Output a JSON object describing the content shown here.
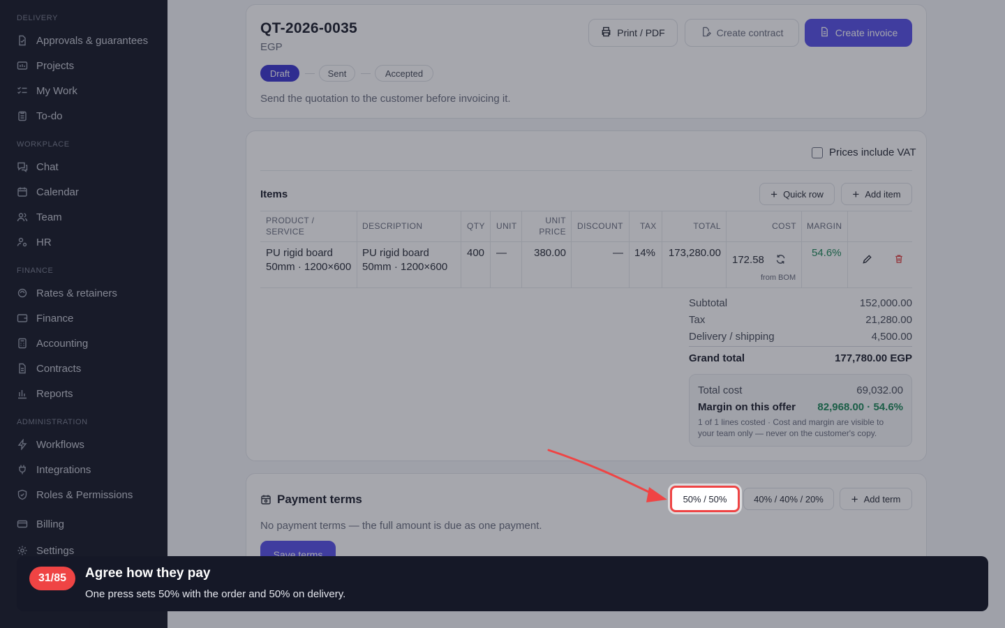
{
  "sidebar": {
    "sections": [
      {
        "label": "DELIVERY",
        "items": [
          "Approvals & guarantees",
          "Projects",
          "My Work",
          "To-do"
        ]
      },
      {
        "label": "WORKPLACE",
        "items": [
          "Chat",
          "Calendar",
          "Team",
          "HR"
        ]
      },
      {
        "label": "FINANCE",
        "items": [
          "Rates & retainers",
          "Finance",
          "Accounting",
          "Contracts",
          "Reports"
        ]
      },
      {
        "label": "ADMINISTRATION",
        "items": [
          "Workflows",
          "Integrations",
          "Roles & Permissions"
        ]
      }
    ],
    "billing": "Billing",
    "settings": "Settings"
  },
  "quote": {
    "number": "QT-2026-0035",
    "currency": "EGP",
    "print_label": "Print / PDF",
    "contract_label": "Create contract",
    "invoice_label": "Create invoice",
    "stages": [
      "Draft",
      "Sent",
      "Accepted"
    ],
    "active_stage": "Draft",
    "hint": "Send the quotation to the customer before invoicing it."
  },
  "items": {
    "vat_label": "Prices include VAT",
    "title": "Items",
    "quick_row": "Quick row",
    "add_item": "Add item",
    "columns": [
      "PRODUCT / SERVICE",
      "DESCRIPTION",
      "QTY",
      "UNIT",
      "UNIT PRICE",
      "DISCOUNT",
      "TAX",
      "TOTAL",
      "COST",
      "MARGIN"
    ],
    "row": {
      "product": "PU rigid board 50mm · 1200×600",
      "description": "PU rigid board 50mm · 1200×600",
      "qty": "400",
      "unit": "—",
      "unit_price": "380.00",
      "discount": "—",
      "tax": "14%",
      "total": "173,280.00",
      "cost": "172.58",
      "cost_note": "from BOM",
      "margin": "54.6%"
    }
  },
  "totals": {
    "subtotal_label": "Subtotal",
    "subtotal": "152,000.00",
    "tax_label": "Tax",
    "tax": "21,280.00",
    "delivery_label": "Delivery / shipping",
    "delivery": "4,500.00",
    "grand_label": "Grand total",
    "grand": "177,780.00 EGP",
    "cost_label": "Total cost",
    "cost": "69,032.00",
    "margin_label": "Margin on this offer",
    "margin": "82,968.00 · 54.6%",
    "note": "1 of 1 lines costed · Cost and margin are visible to your team only — never on the customer's copy."
  },
  "payment": {
    "title": "Payment terms",
    "preset1": "50% / 50%",
    "preset2": "40% / 40% / 20%",
    "add_term": "Add term",
    "empty": "No payment terms — the full amount is due as one payment.",
    "save": "Save terms"
  },
  "tour": {
    "step": "31/85",
    "title": "Agree how they pay",
    "text": "One press sets 50% with the order and 50% on delivery."
  },
  "colors": {
    "accent": "#5b55e8",
    "highlight": "#ef4444",
    "sidebar": "#1b1e2b",
    "positive": "#1f8a5b"
  }
}
